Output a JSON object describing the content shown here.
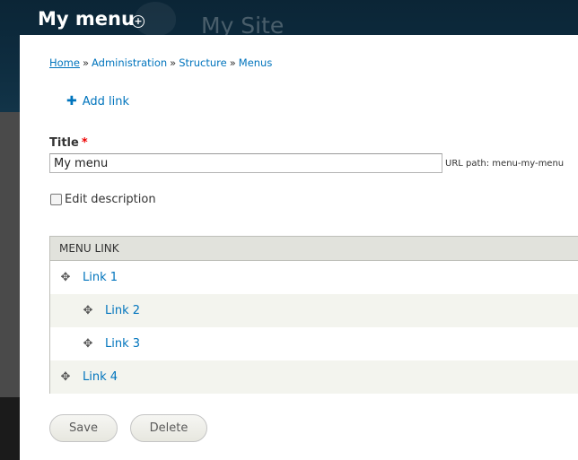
{
  "site": {
    "name": "My Site"
  },
  "overlay": {
    "title": "My menu",
    "shortcut_icon": "plus-circle-icon"
  },
  "breadcrumb": [
    {
      "label": "Home"
    },
    {
      "label": "Administration"
    },
    {
      "label": "Structure"
    },
    {
      "label": "Menus"
    }
  ],
  "breadcrumb_separator": "»",
  "actions": {
    "add_link": "Add link"
  },
  "form": {
    "title_label": "Title",
    "required_marker": "*",
    "title_value": "My menu",
    "url_path": "URL path: menu-my-menu",
    "edit_description": "Edit description"
  },
  "table": {
    "header": "MENU LINK",
    "rows": [
      {
        "label": "Link 1",
        "depth": 0
      },
      {
        "label": "Link 2",
        "depth": 1
      },
      {
        "label": "Link 3",
        "depth": 1
      },
      {
        "label": "Link 4",
        "depth": 0
      }
    ]
  },
  "buttons": {
    "save": "Save",
    "delete": "Delete"
  },
  "colors": {
    "link": "#0074bd",
    "required": "#ee0000",
    "header_bg": "#0e2d40"
  }
}
